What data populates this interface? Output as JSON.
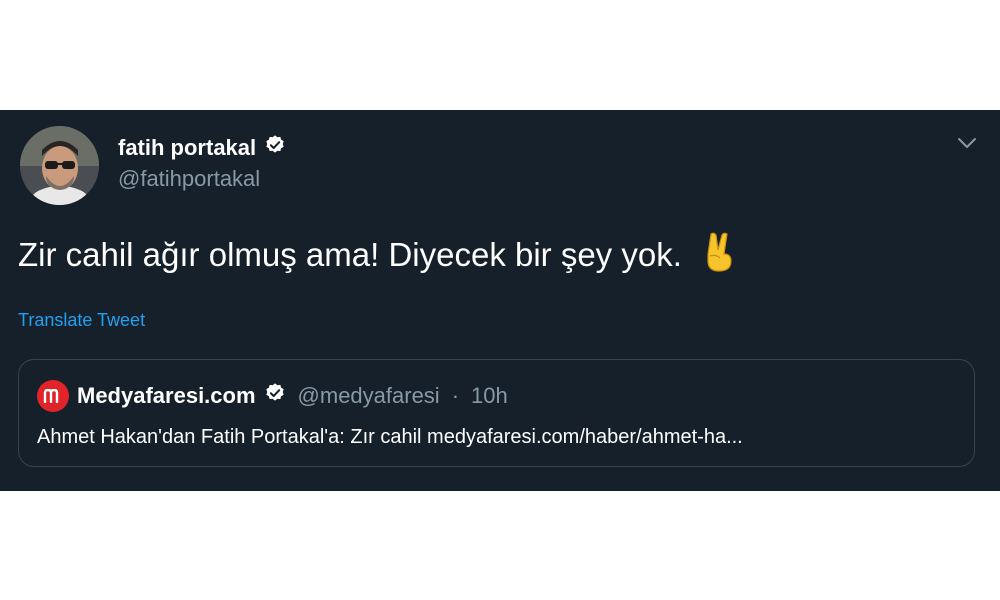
{
  "author": {
    "display_name": "fatih portakal",
    "handle": "@fatihportakal"
  },
  "tweet": {
    "text": "Zir cahil ağır olmuş ama! Diyecek bir şey yok.",
    "translate_link": "Translate Tweet"
  },
  "quoted": {
    "display_name": "Medyafaresi.com",
    "handle": "@medyafaresi",
    "separator": "·",
    "time": "10h",
    "text": "Ahmet Hakan'dan Fatih Portakal'a: Zır cahil medyafaresi.com/haber/ahmet-ha..."
  },
  "icons": {
    "verified": "verified-badge-icon",
    "more": "chevron-down-icon",
    "emoji": "victory-hand-icon",
    "quoted_logo": "medyafaresi-logo-icon"
  },
  "colors": {
    "background": "#15202b",
    "text_primary": "#ffffff",
    "text_secondary": "#8899a6",
    "link": "#1da1f2",
    "border": "#38444d",
    "quoted_logo_red": "#e0242a"
  }
}
